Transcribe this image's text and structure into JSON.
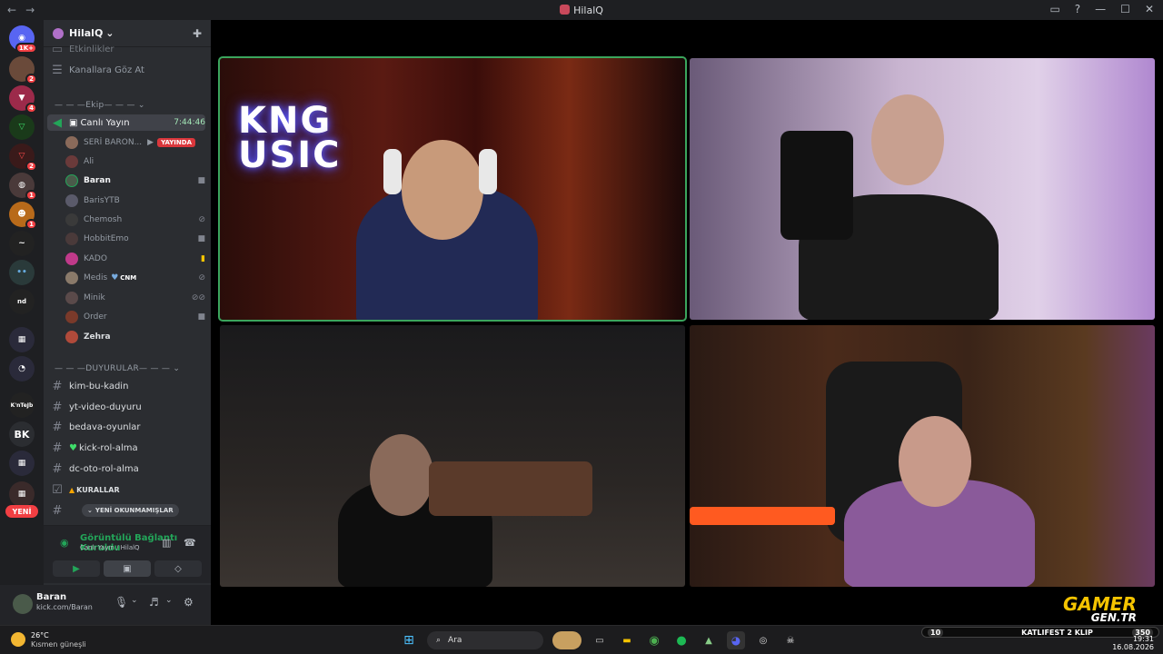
{
  "window": {
    "title": "HilalQ"
  },
  "guilds": {
    "dm_badge": "1K+",
    "badges": [
      "2",
      "4",
      "2",
      "1",
      "1"
    ],
    "bk": "BK",
    "ktj": "K'nTeJb",
    "nd": "nd",
    "new": "YENİ"
  },
  "server": {
    "name": "HilalQ"
  },
  "channels": {
    "events_partial": "Etkinlikler",
    "browse": "Kanallara Göz At",
    "cat_ekip": "Ekip",
    "voice_channel": "Canlı Yayın",
    "voice_timer": "7:44:46",
    "cat_duyurular": "DUYURULAR",
    "text": [
      {
        "label": "kim-bu-kadin"
      },
      {
        "label": "yt-video-duyuru"
      },
      {
        "label": "bedava-oyunlar"
      },
      {
        "label": "kick-rol-alma"
      },
      {
        "label": "dc-oto-rol-alma"
      },
      {
        "label": "KURALLAR"
      }
    ],
    "unread_pill": "YENİ OKUNMAMIŞLAR"
  },
  "voice_users": [
    {
      "name": "SERİ BARON...",
      "live": "YAYINDA"
    },
    {
      "name": "Ali"
    },
    {
      "name": "Baran"
    },
    {
      "name": "BarisYTB"
    },
    {
      "name": "Chemosh"
    },
    {
      "name": "HobbitEmo"
    },
    {
      "name": "KADO"
    },
    {
      "name": "Medis",
      "tag": "CNM"
    },
    {
      "name": "Minik"
    },
    {
      "name": "Order"
    },
    {
      "name": "Zehra"
    }
  ],
  "voice_panel": {
    "status": "Görüntülü Bağlantı Kuruldu",
    "channel": "Canlı Yayın / HilalQ"
  },
  "user_panel": {
    "name": "Baran",
    "status": "kick.com/Baran"
  },
  "stream": {
    "neon_text": "KNG\nUSIC"
  },
  "watermark": {
    "top": "GAMER",
    "bottom": "GEN.TR"
  },
  "taskbar": {
    "temp": "26°C",
    "weather": "Kısmen güneşli",
    "search": "Ara",
    "time": "19:31",
    "date": "16.08.2026",
    "promo_left": "10",
    "promo_text": "KATLIFEST 2 KLIP",
    "promo_count": "350"
  }
}
